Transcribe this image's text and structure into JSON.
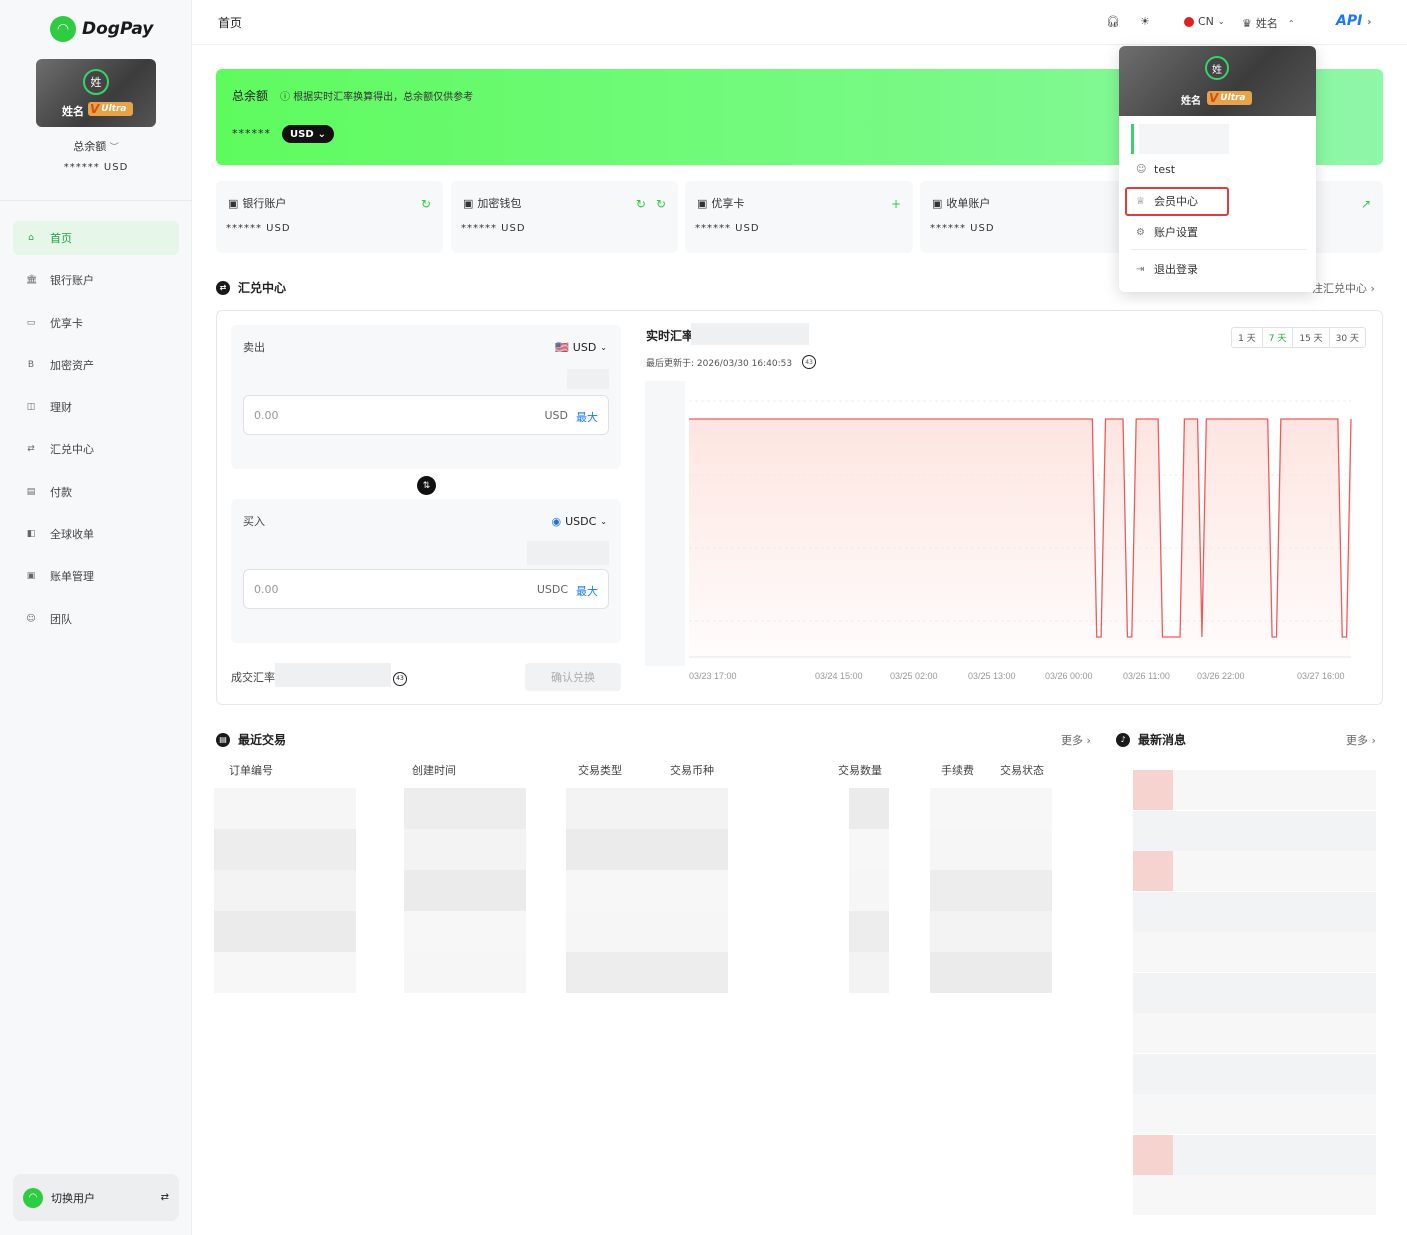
{
  "brand": {
    "name": "DogPay"
  },
  "user": {
    "avatar_char": "姓",
    "name": "姓名",
    "tier": "Ultra",
    "tier_mark": "V"
  },
  "sidebar": {
    "total_label": "总余额",
    "total_value": "****** USD",
    "items": [
      {
        "label": "首页",
        "icon": "home-icon",
        "glyph": "⌂",
        "active": true
      },
      {
        "label": "银行账户",
        "icon": "bank-icon",
        "glyph": "🏛"
      },
      {
        "label": "优享卡",
        "icon": "card-icon",
        "glyph": "▭"
      },
      {
        "label": "加密资产",
        "icon": "bitcoin-icon",
        "glyph": "B"
      },
      {
        "label": "理财",
        "icon": "wealth-icon",
        "glyph": "◫"
      },
      {
        "label": "汇兑中心",
        "icon": "exchange-icon",
        "glyph": "⇄"
      },
      {
        "label": "付款",
        "icon": "payment-icon",
        "glyph": "▤"
      },
      {
        "label": "全球收单",
        "icon": "acquiring-icon",
        "glyph": "◧"
      },
      {
        "label": "账单管理",
        "icon": "bill-icon",
        "glyph": "▣"
      },
      {
        "label": "团队",
        "icon": "team-icon",
        "glyph": "☺"
      }
    ],
    "switch_user": "切换用户"
  },
  "topbar": {
    "title": "首页",
    "lang": "CN",
    "user_name": "姓名",
    "api": "API"
  },
  "banner": {
    "title": "总余额",
    "note": "根据实时汇率换算得出，总余额仅供参考",
    "amount": "******",
    "currency": "USD"
  },
  "accounts": [
    {
      "label": "银行账户",
      "icon": "bank-icon",
      "value": "****** USD"
    },
    {
      "label": "加密钱包",
      "icon": "bitcoin-icon",
      "value": "****** USD"
    },
    {
      "label": "优享卡",
      "icon": "card-icon",
      "value": "****** USD"
    },
    {
      "label": "收单账户",
      "icon": "acquiring-icon",
      "value": "****** USD"
    }
  ],
  "fx": {
    "title": "汇兑中心",
    "more": "注汇兑中心",
    "sell_label": "卖出",
    "sell_currency": "USD",
    "sell_placeholder": "0.00",
    "sell_unit": "USD",
    "max_label": "最大",
    "buy_label": "买入",
    "buy_currency": "USDC",
    "buy_placeholder": "0.00",
    "buy_unit": "USDC",
    "deal_rate_label": "成交汇率",
    "confirm": "确认兑换",
    "countdown": "43",
    "realtime_title": "实时汇率",
    "updated": "最后更新于: 2026/03/30 16:40:53",
    "ranges": [
      "1 天",
      "7 天",
      "15 天",
      "30 天"
    ],
    "active_range": "7 天"
  },
  "chart_data": {
    "type": "area",
    "x_tick_labels": [
      "03/23 17:00",
      "03/24 15:00",
      "03/25 02:00",
      "03/25 13:00",
      "03/26 00:00",
      "03/26 11:00",
      "03/26 22:00",
      "03/27 16:00"
    ],
    "values": [
      1,
      1,
      1,
      1,
      1,
      1,
      1,
      1,
      1,
      1,
      1,
      1,
      1,
      1,
      1,
      1,
      1,
      1,
      1,
      1,
      1,
      1,
      1,
      1,
      1,
      1,
      1,
      1,
      1,
      1,
      1,
      1,
      1,
      1,
      1,
      1,
      1,
      1,
      1,
      1,
      1,
      1,
      1,
      1,
      1,
      1,
      1,
      1,
      1,
      1,
      1,
      1,
      1,
      1,
      1,
      1,
      1,
      1,
      1,
      1,
      1,
      1,
      1,
      1,
      1,
      1,
      1,
      1,
      1,
      1,
      1,
      1,
      1,
      1,
      1,
      1,
      1,
      1,
      1,
      1,
      1,
      1,
      1,
      1,
      1,
      1,
      1,
      1,
      1,
      1,
      1,
      1,
      1,
      0,
      0,
      1,
      1,
      1,
      1,
      1,
      0,
      0,
      1,
      1,
      1,
      1,
      1,
      1,
      0,
      0,
      0,
      0,
      0,
      1,
      1,
      1,
      1,
      0,
      1,
      1,
      1,
      1,
      1,
      1,
      1,
      1,
      1,
      1,
      1,
      1,
      1,
      1,
      1,
      0,
      0,
      1,
      1,
      1,
      1,
      1,
      1,
      1,
      1,
      1,
      1,
      1,
      1,
      1,
      1,
      0,
      0,
      1
    ],
    "color": "#f05a5a"
  },
  "transactions": {
    "title": "最近交易",
    "more": "更多",
    "columns": [
      "订单编号",
      "创建时间",
      "交易类型",
      "交易币种",
      "交易数量",
      "手续费",
      "交易状态"
    ]
  },
  "news": {
    "title": "最新消息",
    "more": "更多"
  },
  "dropdown": {
    "username": "test",
    "items": [
      {
        "label": "会员中心",
        "icon": "crown-icon",
        "glyph": "♕"
      },
      {
        "label": "账户设置",
        "icon": "gear-icon",
        "glyph": "⚙"
      },
      {
        "label": "退出登录",
        "icon": "logout-icon",
        "glyph": "⇥"
      }
    ]
  }
}
